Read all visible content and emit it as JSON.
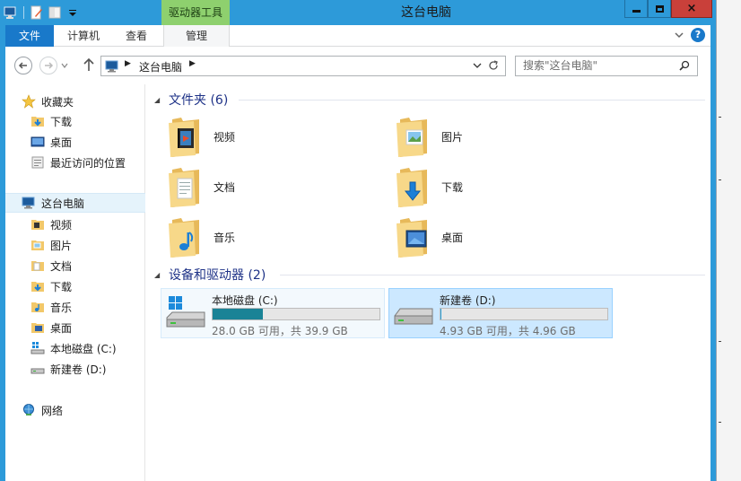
{
  "window": {
    "title": "这台电脑",
    "contextual_tab": "驱动器工具",
    "close_glyph": "×"
  },
  "ribbon": {
    "tabs": [
      "文件",
      "计算机",
      "查看",
      "管理"
    ],
    "help": "?"
  },
  "address": {
    "path": "这台电脑",
    "search_placeholder": "搜索\"这台电脑\""
  },
  "nav_pane": {
    "favorites_label": "收藏夹",
    "favorites": [
      "下载",
      "桌面",
      "最近访问的位置"
    ],
    "this_pc_label": "这台电脑",
    "this_pc_children": [
      "视频",
      "图片",
      "文档",
      "下载",
      "音乐",
      "桌面",
      "本地磁盘 (C:)",
      "新建卷 (D:)"
    ],
    "network_label": "网络"
  },
  "folders_group": {
    "title": "文件夹 (6)",
    "items": [
      {
        "name": "视频",
        "icon": "videos-folder-icon"
      },
      {
        "name": "图片",
        "icon": "pictures-folder-icon"
      },
      {
        "name": "文档",
        "icon": "documents-folder-icon"
      },
      {
        "name": "下载",
        "icon": "downloads-folder-icon"
      },
      {
        "name": "音乐",
        "icon": "music-folder-icon"
      },
      {
        "name": "桌面",
        "icon": "desktop-folder-icon"
      }
    ]
  },
  "drives_group": {
    "title": "设备和驱动器 (2)",
    "drives": [
      {
        "name": "本地磁盘 (C:)",
        "space": "28.0 GB 可用，共 39.9 GB",
        "used_fraction": 0.3,
        "bar_color": "#1a8396"
      },
      {
        "name": "新建卷 (D:)",
        "space": "4.93 GB 可用，共 4.96 GB",
        "used_fraction": 0.006,
        "bar_color": "#26a0da"
      }
    ]
  },
  "colors": {
    "title_bar": "#2d9ad9",
    "file_tab": "#1979ca",
    "contextual_tab": "#8ed06e",
    "group_header": "#1e3287",
    "selection": "#cce8ff"
  }
}
